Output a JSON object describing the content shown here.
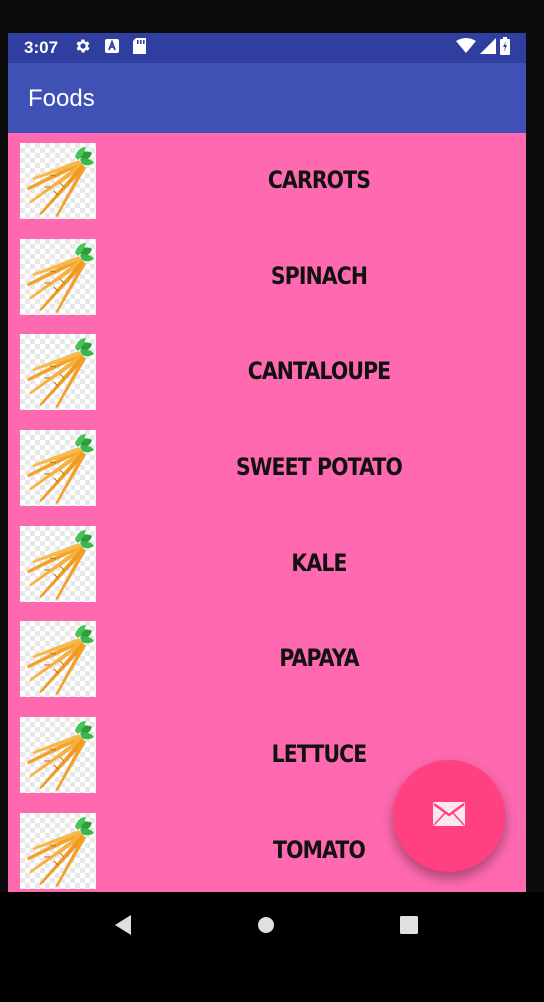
{
  "status_bar": {
    "time": "3:07",
    "left_icons": [
      "gear-icon",
      "text-a-icon",
      "sd-card-icon"
    ],
    "right_icons": [
      "wifi-icon",
      "signal-icon",
      "battery-icon"
    ]
  },
  "app_bar": {
    "title": "Foods"
  },
  "foods": [
    {
      "label": "CARROTS",
      "icon": "carrots-image"
    },
    {
      "label": "SPINACH",
      "icon": "carrots-image"
    },
    {
      "label": "CANTALOUPE",
      "icon": "carrots-image"
    },
    {
      "label": "SWEET POTATO",
      "icon": "carrots-image"
    },
    {
      "label": "KALE",
      "icon": "carrots-image"
    },
    {
      "label": "PAPAYA",
      "icon": "carrots-image"
    },
    {
      "label": "LETTUCE",
      "icon": "carrots-image"
    },
    {
      "label": "TOMATO",
      "icon": "carrots-image"
    }
  ],
  "fab": {
    "icon": "email-icon",
    "color": "#ff4081"
  },
  "nav": {
    "buttons": [
      "back-icon",
      "home-icon",
      "recents-icon"
    ]
  },
  "colors": {
    "status_bar": "#303f9f",
    "app_bar": "#3f51b5",
    "list_background": "#ff69b0"
  }
}
